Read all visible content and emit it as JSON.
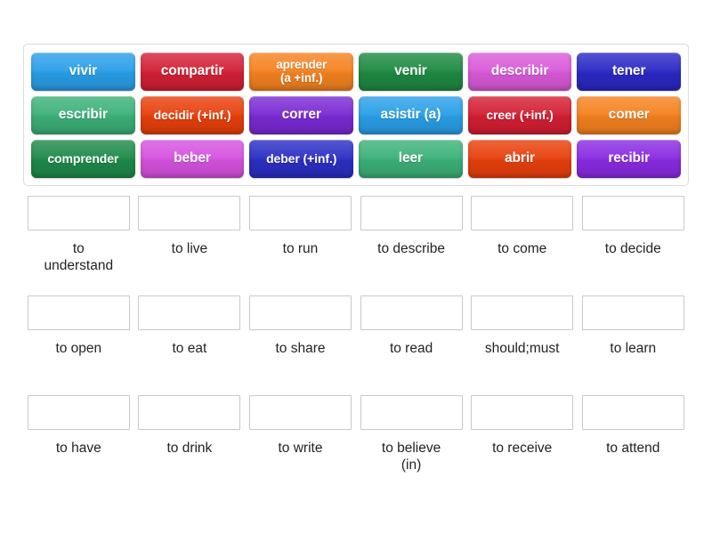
{
  "activity": {
    "type": "match-up",
    "tile_text_color": "#ffffff",
    "dropzone_border_color": "#c9c9c9",
    "container_border_color": "#dcdcdc",
    "label_color": "#232323"
  },
  "tiles": [
    {
      "id": "tile-vivir",
      "label": "vivir",
      "color": "#2a9fe8",
      "lines": 1
    },
    {
      "id": "tile-compartir",
      "label": "compartir",
      "color": "#d32036",
      "lines": 1
    },
    {
      "id": "tile-aprender",
      "label": "aprender\n(a +inf.)",
      "color": "#f58220",
      "lines": 2
    },
    {
      "id": "tile-venir",
      "label": "venir",
      "color": "#1e8a42",
      "lines": 1
    },
    {
      "id": "tile-describir",
      "label": "describir",
      "color": "#d95ad9",
      "lines": 1
    },
    {
      "id": "tile-tener",
      "label": "tener",
      "color": "#2a29c4",
      "lines": 1
    },
    {
      "id": "tile-escribir",
      "label": "escribir",
      "color": "#3cb179",
      "lines": 1
    },
    {
      "id": "tile-decidir",
      "label": "decidir (+inf.)",
      "color": "#e8400c",
      "lines": 1,
      "small": true
    },
    {
      "id": "tile-correr",
      "label": "correr",
      "color": "#7a2ad4",
      "lines": 1
    },
    {
      "id": "tile-asistir",
      "label": "asistir (a)",
      "color": "#2a9fe8",
      "lines": 1
    },
    {
      "id": "tile-creer",
      "label": "creer (+inf.)",
      "color": "#d41f33",
      "lines": 1,
      "small": true
    },
    {
      "id": "tile-comer",
      "label": "comer",
      "color": "#f5811f",
      "lines": 1
    },
    {
      "id": "tile-comprender",
      "label": "comprender",
      "color": "#1e8a4a",
      "lines": 1,
      "small": true
    },
    {
      "id": "tile-beber",
      "label": "beber",
      "color": "#d652e0",
      "lines": 1
    },
    {
      "id": "tile-deber",
      "label": "deber (+inf.)",
      "color": "#2b2fc4",
      "lines": 1,
      "small": true
    },
    {
      "id": "tile-leer",
      "label": "leer",
      "color": "#3cb179",
      "lines": 1
    },
    {
      "id": "tile-abrir",
      "label": "abrir",
      "color": "#e8400c",
      "lines": 1
    },
    {
      "id": "tile-recibir",
      "label": "recibir",
      "color": "#8a2be2",
      "lines": 1
    }
  ],
  "answers": [
    {
      "id": "answer-to-understand",
      "label": "to\nunderstand",
      "value": ""
    },
    {
      "id": "answer-to-live",
      "label": "to live",
      "value": ""
    },
    {
      "id": "answer-to-run",
      "label": "to run",
      "value": ""
    },
    {
      "id": "answer-to-describe",
      "label": "to describe",
      "value": ""
    },
    {
      "id": "answer-to-come",
      "label": "to come",
      "value": ""
    },
    {
      "id": "answer-to-decide",
      "label": "to decide",
      "value": ""
    },
    {
      "id": "answer-to-open",
      "label": "to open",
      "value": ""
    },
    {
      "id": "answer-to-eat",
      "label": "to eat",
      "value": ""
    },
    {
      "id": "answer-to-share",
      "label": "to share",
      "value": ""
    },
    {
      "id": "answer-to-read",
      "label": "to read",
      "value": ""
    },
    {
      "id": "answer-should-must",
      "label": "should;must",
      "value": ""
    },
    {
      "id": "answer-to-learn",
      "label": "to learn",
      "value": ""
    },
    {
      "id": "answer-to-have",
      "label": "to have",
      "value": ""
    },
    {
      "id": "answer-to-drink",
      "label": "to drink",
      "value": ""
    },
    {
      "id": "answer-to-write",
      "label": "to write",
      "value": ""
    },
    {
      "id": "answer-to-believe",
      "label": "to believe\n(in)",
      "value": ""
    },
    {
      "id": "answer-to-receive",
      "label": "to receive",
      "value": ""
    },
    {
      "id": "answer-to-attend",
      "label": "to attend",
      "value": ""
    }
  ]
}
